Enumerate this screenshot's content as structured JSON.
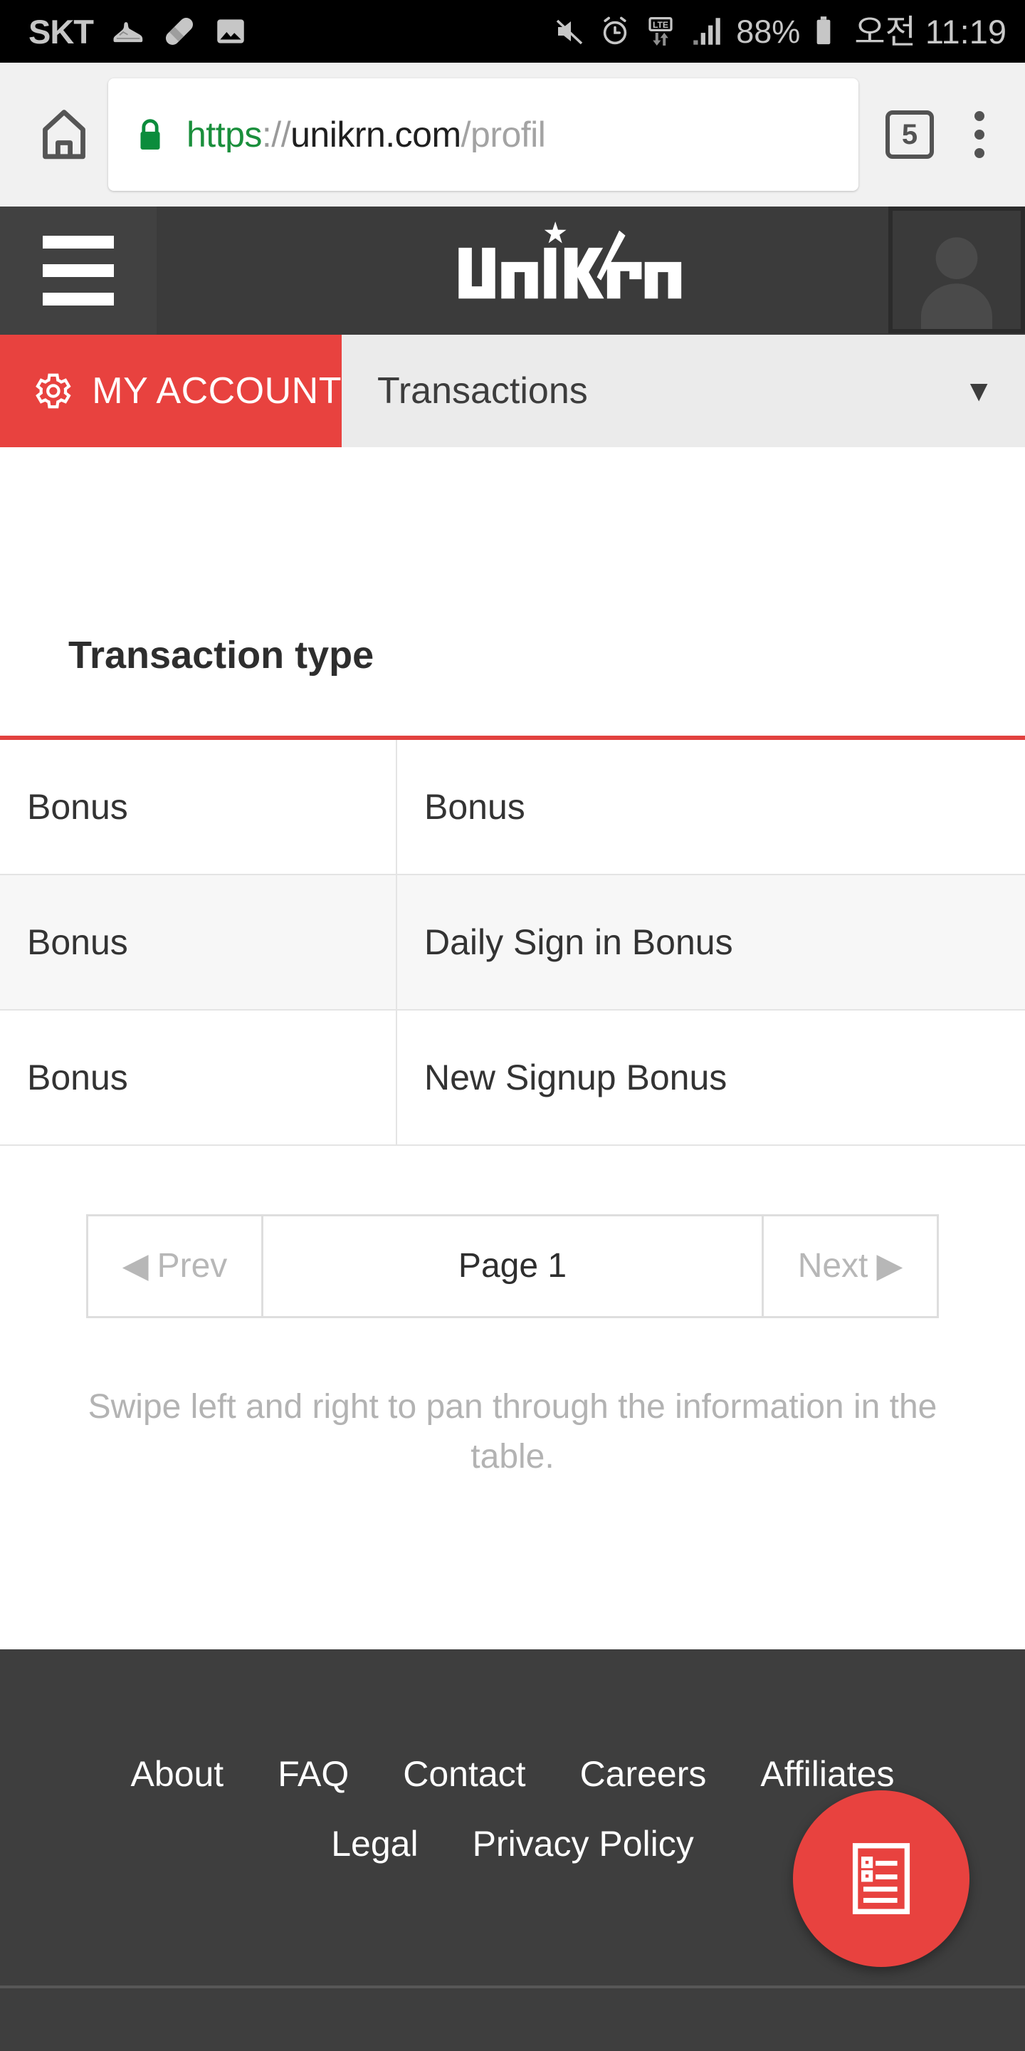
{
  "status_bar": {
    "carrier": "SKT",
    "icons_left": [
      "sneaker-icon",
      "pill-icon",
      "gallery-image-icon"
    ],
    "icons_right": [
      "mute-icon",
      "alarm-clock-icon",
      "lte-data-icon",
      "signal-bars-icon"
    ],
    "battery_percent": "88%",
    "battery_icon": "battery-icon",
    "time": "오전 11:19"
  },
  "browser": {
    "home_icon": "home-icon",
    "lock_icon": "lock-secure-icon",
    "url": {
      "scheme": "https",
      "separator": "://",
      "host": "unikrn.com",
      "path": "/profil"
    },
    "tab_count": "5",
    "menu_icon": "overflow-menu-icon"
  },
  "site_header": {
    "menu_icon": "hamburger-menu-icon",
    "logo_text": "UNIKRN",
    "avatar_icon": "user-avatar-placeholder-icon"
  },
  "account_bar": {
    "gear_icon": "gear-icon",
    "my_account_label": "MY ACCOUNT",
    "selected_section": "Transactions",
    "caret": "▼",
    "options": [
      "Transactions"
    ]
  },
  "main": {
    "section_title": "Transaction type",
    "table": {
      "columns": [
        "Transaction type",
        ""
      ],
      "rows": [
        {
          "type": "Bonus",
          "description": "Bonus"
        },
        {
          "type": "Bonus",
          "description": "Daily Sign in Bonus"
        },
        {
          "type": "Bonus",
          "description": "New Signup Bonus"
        }
      ]
    },
    "pagination": {
      "prev_arrow": "◀",
      "prev_label": "Prev",
      "page_label": "Page 1",
      "next_label": "Next",
      "next_arrow": "▶"
    },
    "swipe_hint": "Swipe left and right to pan through the information in the table."
  },
  "footer": {
    "row1": [
      "About",
      "FAQ",
      "Contact",
      "Careers",
      "Affiliates"
    ],
    "row2": [
      "Legal",
      "Privacy Policy"
    ],
    "fab_icon": "bet-slip-list-icon"
  },
  "colors": {
    "brand_red": "#e8423f",
    "header_dark": "#3b3b3b",
    "footer_dark": "#3e3e3e",
    "table_accent": "#e2413f",
    "secure_green": "#1a8f3c"
  }
}
